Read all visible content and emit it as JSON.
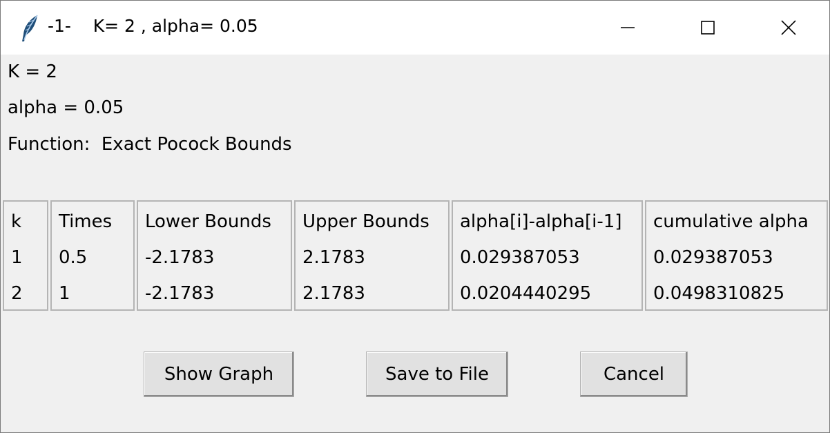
{
  "window": {
    "title": "-1-    K= 2 , alpha= 0.05",
    "icon": "feather-icon"
  },
  "info": {
    "k_line": "K = 2",
    "alpha_line": "alpha = 0.05",
    "function_line": "Function:  Exact Pocock Bounds"
  },
  "table": {
    "columns": [
      {
        "header": "k",
        "values": [
          "1",
          "2"
        ]
      },
      {
        "header": "Times",
        "values": [
          "0.5",
          "1"
        ]
      },
      {
        "header": "Lower Bounds",
        "values": [
          "-2.1783",
          "-2.1783"
        ]
      },
      {
        "header": "Upper Bounds",
        "values": [
          "2.1783",
          "2.1783"
        ]
      },
      {
        "header": "alpha[i]-alpha[i-1]",
        "values": [
          "0.029387053",
          "0.0204440295"
        ]
      },
      {
        "header": "cumulative alpha",
        "values": [
          "0.029387053",
          "0.0498310825"
        ]
      }
    ]
  },
  "buttons": {
    "show_graph": "Show Graph",
    "save_to_file": "Save to File",
    "cancel": "Cancel"
  }
}
